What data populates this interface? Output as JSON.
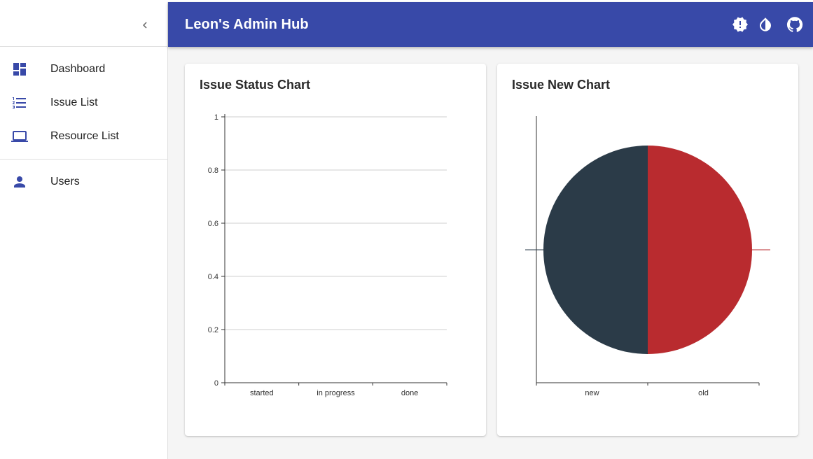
{
  "app": {
    "title": "Leon's Admin Hub"
  },
  "sidebar": {
    "groups": [
      [
        {
          "label": "Dashboard",
          "icon": "dashboard-icon"
        },
        {
          "label": "Issue List",
          "icon": "list-icon"
        },
        {
          "label": "Resource List",
          "icon": "laptop-icon"
        }
      ],
      [
        {
          "label": "Users",
          "icon": "person-icon"
        }
      ]
    ]
  },
  "toolbar": {
    "icons": [
      "alert-badge-icon",
      "contrast-icon",
      "github-icon"
    ]
  },
  "colors": {
    "appbar": "#3849a8",
    "accent": "#3849a8",
    "new": "#2b3b48",
    "old": "#b92b2f"
  },
  "cards": [
    {
      "title": "Issue Status Chart"
    },
    {
      "title": "Issue New Chart"
    }
  ],
  "chart_data": [
    {
      "type": "bar",
      "categories": [
        "started",
        "in progress",
        "done"
      ],
      "values": [
        0,
        0,
        0
      ],
      "ylim": [
        0,
        1
      ],
      "yticks": [
        "0",
        "0.2",
        "0.4",
        "0.6",
        "0.8",
        "1"
      ],
      "grid": true
    },
    {
      "type": "pie",
      "categories": [
        "new",
        "old"
      ],
      "values": [
        1,
        1
      ],
      "colors": [
        "#2b3b48",
        "#b92b2f"
      ]
    }
  ]
}
